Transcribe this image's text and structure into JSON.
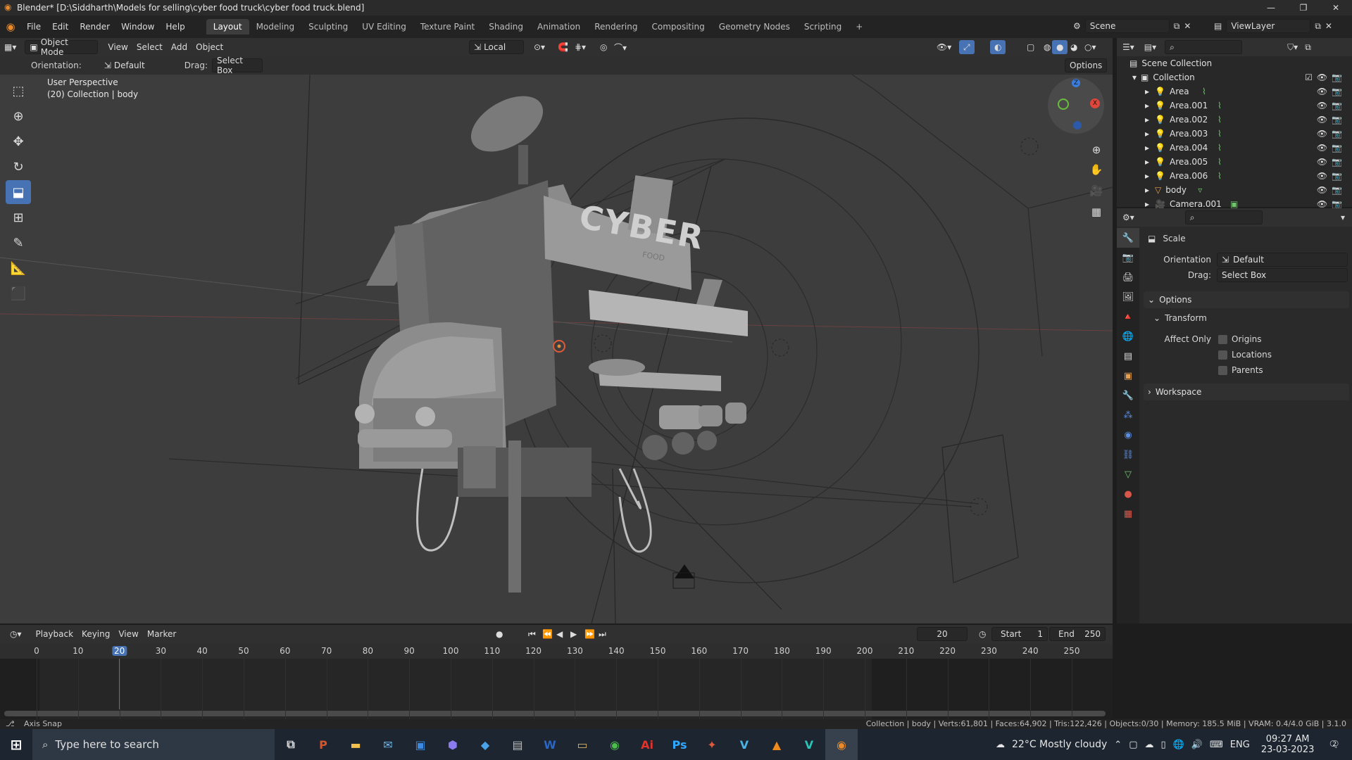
{
  "window": {
    "title": "Blender* [D:\\Siddharth\\Models for selling\\cyber food truck\\cyber food truck.blend]"
  },
  "menu": [
    "File",
    "Edit",
    "Render",
    "Window",
    "Help"
  ],
  "workspaces": [
    "Layout",
    "Modeling",
    "Sculpting",
    "UV Editing",
    "Texture Paint",
    "Shading",
    "Animation",
    "Rendering",
    "Compositing",
    "Geometry Nodes",
    "Scripting"
  ],
  "active_workspace": "Layout",
  "scene": {
    "name": "Scene",
    "view_layer": "ViewLayer"
  },
  "viewport_header": {
    "mode": "Object Mode",
    "menus": [
      "View",
      "Select",
      "Add",
      "Object"
    ],
    "transform_orientation": "Local",
    "options_label": "Options"
  },
  "tool_settings": {
    "orientation_label": "Orientation:",
    "orientation_value": "Default",
    "drag_label": "Drag:",
    "drag_value": "Select Box"
  },
  "viewport": {
    "perspective": "User Perspective",
    "collection_info": "(20) Collection | body",
    "truck_sign": "CYBER",
    "truck_subtitle": "FOOD"
  },
  "outliner": {
    "scene_collection": "Scene Collection",
    "collection": "Collection",
    "items": [
      "Area",
      "Area.001",
      "Area.002",
      "Area.003",
      "Area.004",
      "Area.005",
      "Area.006",
      "body",
      "Camera.001"
    ]
  },
  "properties": {
    "tool_name": "Scale",
    "orientation_label": "Orientation",
    "orientation_value": "Default",
    "drag_label": "Drag:",
    "drag_value": "Select Box",
    "options_panel": "Options",
    "transform_panel": "Transform",
    "affect_only_label": "Affect Only",
    "affect_options": [
      "Origins",
      "Locations",
      "Parents"
    ],
    "workspace_panel": "Workspace"
  },
  "timeline": {
    "menus": [
      "Playback",
      "Keying",
      "View",
      "Marker"
    ],
    "current_frame": "20",
    "start_label": "Start",
    "start_value": "1",
    "end_label": "End",
    "end_value": "250",
    "ticks": [
      "0",
      "10",
      "20",
      "30",
      "40",
      "50",
      "60",
      "70",
      "80",
      "90",
      "100",
      "110",
      "120",
      "130",
      "140",
      "150",
      "160",
      "170",
      "180",
      "190",
      "200",
      "210",
      "220",
      "230",
      "240",
      "250"
    ]
  },
  "status_bar": {
    "left": "Axis Snap",
    "right": "Collection | body | Verts:61,801 | Faces:64,902 | Tris:122,426 | Objects:0/30 | Memory: 185.5 MiB | VRAM: 0.4/4.0 GiB | 3.1.0"
  },
  "taskbar": {
    "search_placeholder": "Type here to search",
    "weather": "22°C  Mostly cloudy",
    "language": "ENG",
    "time": "09:27 AM",
    "date": "23-03-2023",
    "notifications": "2"
  }
}
